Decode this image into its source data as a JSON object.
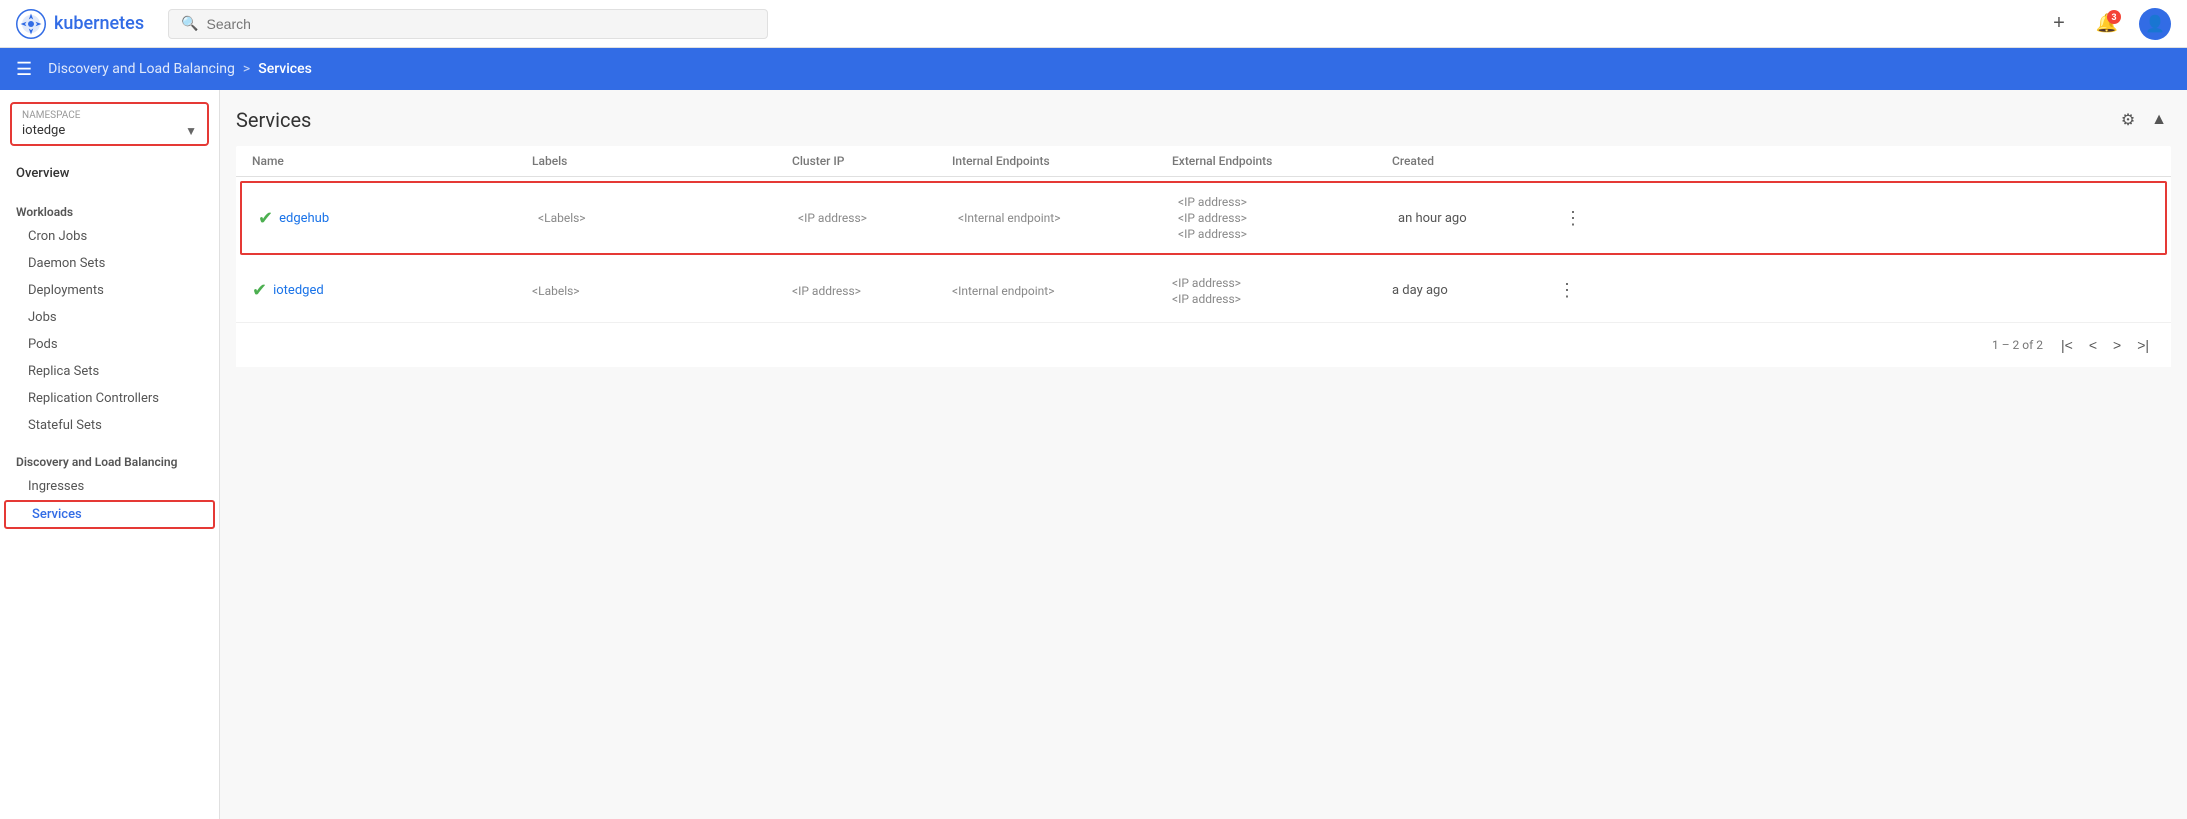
{
  "app": {
    "name": "kubernetes"
  },
  "topnav": {
    "search_placeholder": "Search",
    "notif_count": "3",
    "add_label": "+"
  },
  "breadcrumb": {
    "menu_icon": "☰",
    "parent": "Discovery and Load Balancing",
    "separator": ">",
    "current": "Services"
  },
  "sidebar": {
    "namespace_label": "Namespace",
    "namespace_value": "iotedge",
    "overview": "Overview",
    "groups": [
      {
        "label": "Workloads",
        "items": [
          {
            "id": "cron-jobs",
            "label": "Cron Jobs",
            "active": false
          },
          {
            "id": "daemon-sets",
            "label": "Daemon Sets",
            "active": false
          },
          {
            "id": "deployments",
            "label": "Deployments",
            "active": false
          },
          {
            "id": "jobs",
            "label": "Jobs",
            "active": false
          },
          {
            "id": "pods",
            "label": "Pods",
            "active": false
          },
          {
            "id": "replica-sets",
            "label": "Replica Sets",
            "active": false
          },
          {
            "id": "replication-controllers",
            "label": "Replication Controllers",
            "active": false
          },
          {
            "id": "stateful-sets",
            "label": "Stateful Sets",
            "active": false
          }
        ]
      },
      {
        "label": "Discovery and Load Balancing",
        "items": [
          {
            "id": "ingresses",
            "label": "Ingresses",
            "active": false
          },
          {
            "id": "services",
            "label": "Services",
            "active": true
          }
        ]
      }
    ]
  },
  "page": {
    "title": "Services"
  },
  "table": {
    "columns": [
      "Name",
      "Labels",
      "Cluster IP",
      "Internal Endpoints",
      "External Endpoints",
      "Created"
    ],
    "rows": [
      {
        "status": "ok",
        "name": "edgehub",
        "labels": "<Labels>",
        "cluster_ip": "<IP address>",
        "internal_endpoint": "<Internal endpoint>",
        "external_endpoints": [
          "<IP address>",
          "<IP address>",
          "<IP address>"
        ],
        "created": "an hour ago",
        "highlighted": true
      },
      {
        "status": "ok",
        "name": "iotedged",
        "labels": "<Labels>",
        "cluster_ip": "<IP address>",
        "internal_endpoint": "<Internal endpoint>",
        "external_endpoints": [
          "<IP address>",
          "<IP address>"
        ],
        "created": "a day ago",
        "highlighted": false
      }
    ]
  },
  "pagination": {
    "info": "1 – 2 of 2",
    "first_label": "⟨⟨",
    "prev_label": "⟨",
    "next_label": "⟩",
    "last_label": "⟩⟩"
  }
}
